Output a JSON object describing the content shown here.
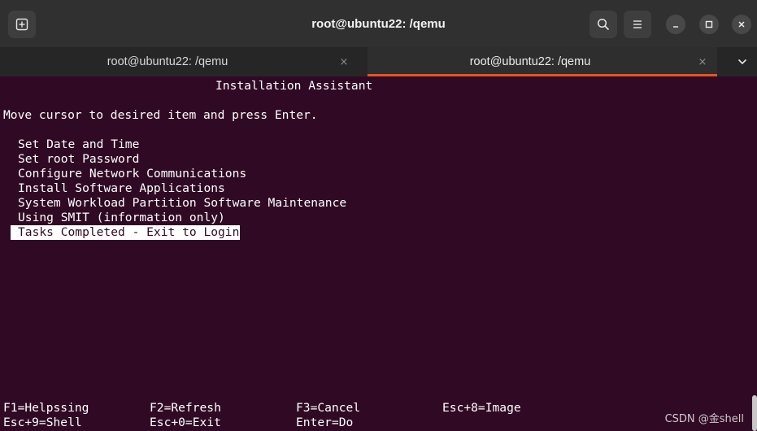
{
  "window": {
    "title": "root@ubuntu22: /qemu",
    "buttons": {
      "new_tab_icon": "new-tab-icon",
      "search_icon": "search-icon",
      "menu_icon": "hamburger-menu-icon",
      "minimize_icon": "minimize-icon",
      "maximize_icon": "maximize-icon",
      "close_icon": "close-icon"
    }
  },
  "tabs": [
    {
      "label": "root@ubuntu22: /qemu",
      "active": false,
      "close": "×"
    },
    {
      "label": "root@ubuntu22: /qemu",
      "active": true,
      "close": "×"
    }
  ],
  "terminal": {
    "heading": "Installation Assistant",
    "instruction": "Move cursor to desired item and press Enter.",
    "menu_items": [
      "Set Date and Time",
      "Set root Password",
      "Configure Network Communications",
      "Install Software Applications",
      "System Workload Partition Software Maintenance",
      "Using SMIT (information only)",
      "Tasks Completed - Exit to Login"
    ],
    "selected_index": 6,
    "function_keys": [
      [
        "F1=Helpssing",
        "F2=Refresh",
        "F3=Cancel",
        "Esc+8=Image"
      ],
      [
        "Esc+9=Shell",
        "Esc+0=Exit",
        "Enter=Do"
      ]
    ]
  },
  "watermark": "CSDN @金shell",
  "colors": {
    "terminal_bg": "#300a24",
    "accent": "#e95420",
    "header_bg": "#303030"
  }
}
